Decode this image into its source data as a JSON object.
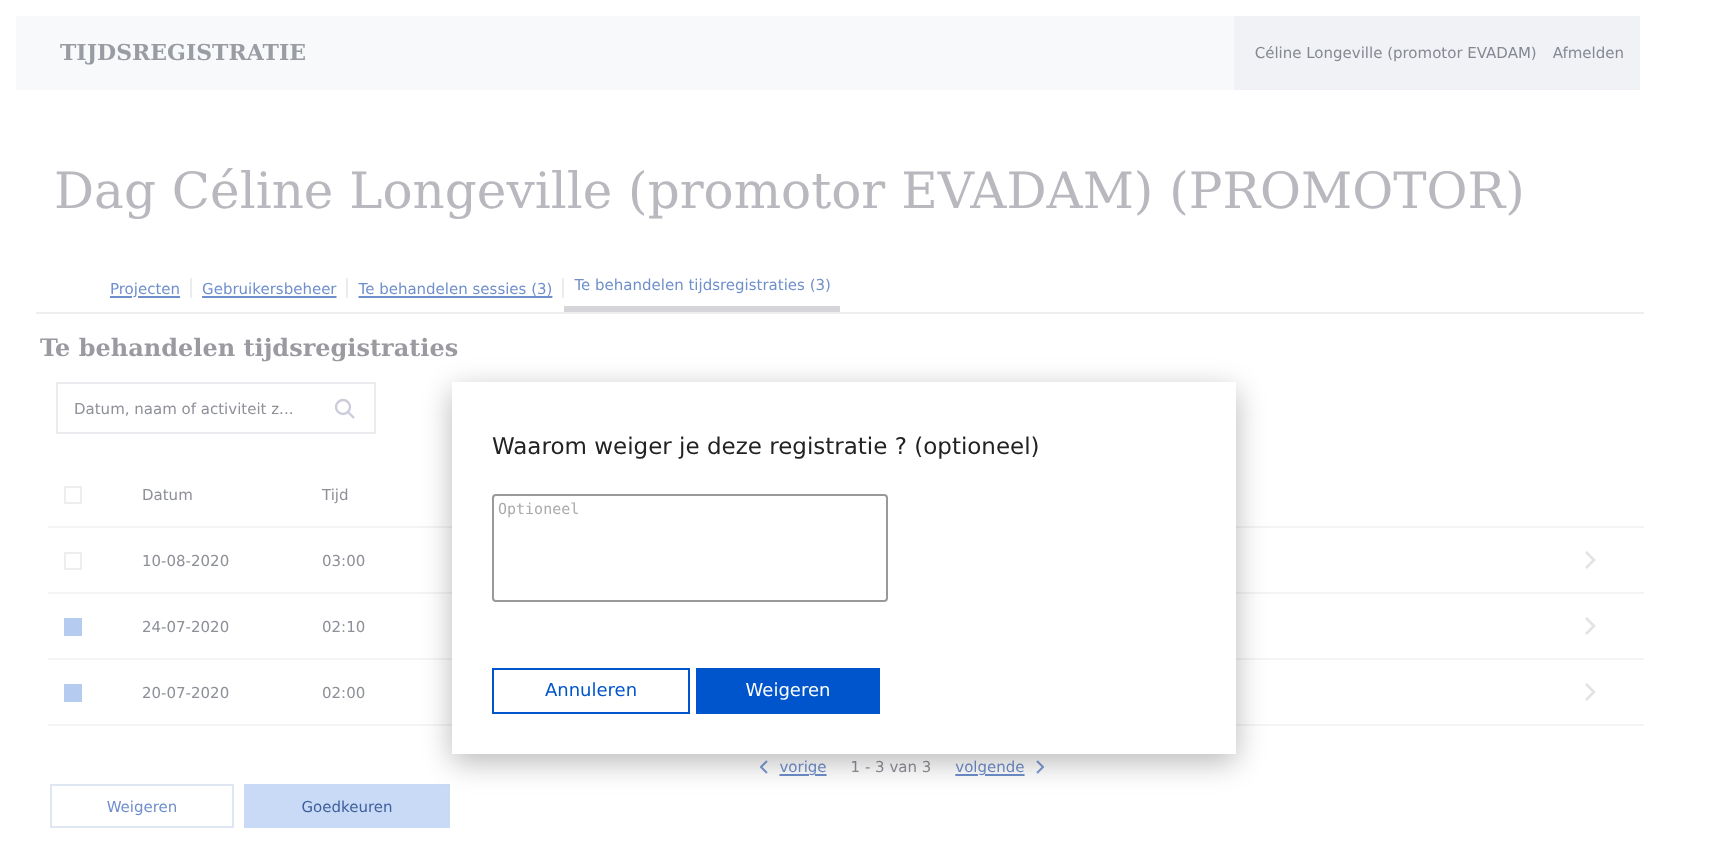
{
  "header": {
    "app_title": "TIJDSREGISTRATIE",
    "user": "Céline Longeville (promotor EVADAM)",
    "logout": "Afmelden"
  },
  "page_title": "Dag Céline Longeville (promotor EVADAM) (PROMOTOR)",
  "tabs": [
    {
      "label": "Projecten",
      "selected": false
    },
    {
      "label": "Gebruikersbeheer",
      "selected": false
    },
    {
      "label": "Te behandelen sessies (3)",
      "selected": false
    },
    {
      "label": "Te behandelen tijdsregistraties (3)",
      "selected": true
    }
  ],
  "section_title": "Te behandelen tijdsregistraties",
  "search": {
    "placeholder": "Datum, naam of activiteit z..."
  },
  "table": {
    "columns": [
      "Datum",
      "Tijd"
    ],
    "select_all": {
      "checked": false
    },
    "rows": [
      {
        "checked": false,
        "date": "10-08-2020",
        "time": "03:00"
      },
      {
        "checked": true,
        "date": "24-07-2020",
        "time": "02:10"
      },
      {
        "checked": true,
        "date": "20-07-2020",
        "time": "02:00"
      }
    ]
  },
  "pagination": {
    "previous": "vorige",
    "range": "1 - 3 van 3",
    "next": "volgende"
  },
  "actions": [
    "Weigeren",
    "Goedkeuren"
  ],
  "dialog": {
    "title": "Waarom weiger je deze registratie ? (optioneel)",
    "field": {
      "placeholder": "Optioneel"
    },
    "buttons": [
      {
        "label": "Annuleren",
        "kind": "secondary"
      },
      {
        "label": "Weigeren",
        "kind": "primary"
      }
    ]
  }
}
